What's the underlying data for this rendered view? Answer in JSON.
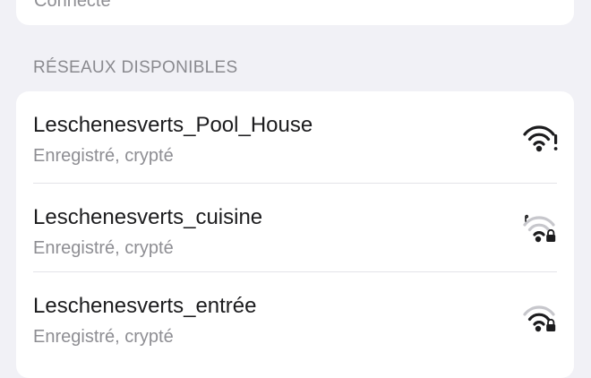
{
  "top_card": {
    "status": "Connecté"
  },
  "section": {
    "title": "RÉSEAUX DISPONIBLES"
  },
  "networks": [
    {
      "name": "Leschenesverts_Pool_House",
      "status": "Enregistré, crypté",
      "icon": "wifi-warning-icon"
    },
    {
      "name": "Leschenesverts_cuisine",
      "status": "Enregistré, crypté",
      "icon": "wifi-lock-weak-icon"
    },
    {
      "name": "Leschenesverts_entrée",
      "status": "Enregistré, crypté",
      "icon": "wifi-lock-icon"
    }
  ],
  "colors": {
    "background": "#f1f1f6",
    "card": "#ffffff",
    "primary_text": "#1c1c1e",
    "secondary_text": "#8e8e93",
    "icon": "#1c1c1e",
    "icon_dim": "#c7c7cc"
  }
}
